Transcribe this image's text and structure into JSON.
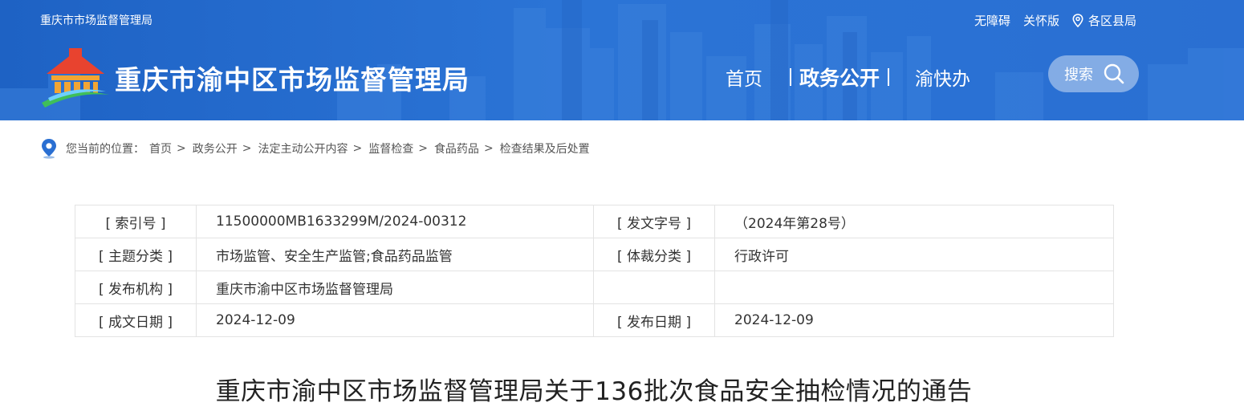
{
  "header": {
    "site_name_small": "重庆市市场监督管理局",
    "title": "重庆市渝中区市场监督管理局",
    "top_links": [
      "无障碍",
      "关怀版"
    ],
    "location_link": "各区县局",
    "nav": {
      "home": "首页",
      "gov_affairs": "政务公开",
      "yukuaiban": "渝快办"
    },
    "search_label": "搜索",
    "colors": {
      "header_bg": "#2a6fd2",
      "text": "#ffffff"
    }
  },
  "breadcrumb": {
    "label": "您当前的位置：",
    "items": [
      "首页",
      "政务公开",
      "法定主动公开内容",
      "监督检查",
      "食品药品",
      "检查结果及后处置"
    ]
  },
  "meta": {
    "rows": [
      {
        "k1": "[ 索引号 ]",
        "v1": "11500000MB1633299M/2024-00312",
        "k2": "[ 发文字号 ]",
        "v2": "（2024年第28号）"
      },
      {
        "k1": "[ 主题分类 ]",
        "v1": "市场监管、安全生产监管;食品药品监管",
        "k2": "[ 体裁分类 ]",
        "v2": "行政许可"
      },
      {
        "k1": "[ 发布机构 ]",
        "v1": "重庆市渝中区市场监督管理局",
        "k2": "",
        "v2": ""
      },
      {
        "k1": "[ 成文日期 ]",
        "v1": "2024-12-09",
        "k2": "[ 发布日期 ]",
        "v2": "2024-12-09"
      }
    ]
  },
  "article": {
    "title": "重庆市渝中区市场监督管理局关于136批次食品安全抽检情况的通告"
  }
}
